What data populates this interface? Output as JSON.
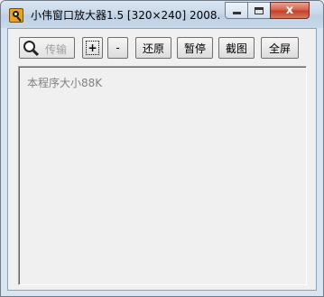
{
  "window": {
    "title": "小伟窗口放大器1.5 [320×240] 2008...",
    "close_glyph": "x",
    "app_icon": "magnifier-app-icon"
  },
  "toolbar": {
    "magnifier_icon": "magnifier-icon",
    "transfer_label": "传输",
    "zoom_in_label": "+",
    "zoom_out_label": "-",
    "restore_label": "还原",
    "pause_label": "暂停",
    "screenshot_label": "截图",
    "fullscreen_label": "全屏"
  },
  "view": {
    "text": "本程序大小88K"
  }
}
